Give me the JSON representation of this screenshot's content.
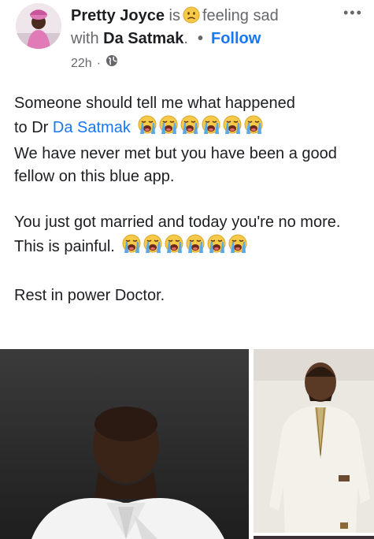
{
  "post": {
    "author": "Pretty Joyce",
    "is_text": "is",
    "feeling_text": "feeling sad",
    "with_text": "with",
    "tagged": "Da Satmak",
    "tagged_period": ".",
    "follow_label": "Follow",
    "more_label": "•••",
    "time": "22h",
    "meta_sep": "·",
    "audience_icon": "globe-icon",
    "feeling_icon": "sad-face-emoji",
    "body": {
      "line1": "Someone should tell me what happened",
      "line2_prefix": "to Dr ",
      "line2_mention": "Da Satmak",
      "line3": "We have never met but you have been a good fellow on this blue app.",
      "line4": "You just got married and today you're no more.",
      "line5": "This is painful.",
      "line6": "Rest in power Doctor.",
      "crying_emoji": "loudly-crying-face-emoji",
      "crying_count_1": 6,
      "crying_count_2": 6
    }
  },
  "colors": {
    "link": "#1877f2",
    "muted": "#65676b",
    "text": "#1c1e21"
  }
}
